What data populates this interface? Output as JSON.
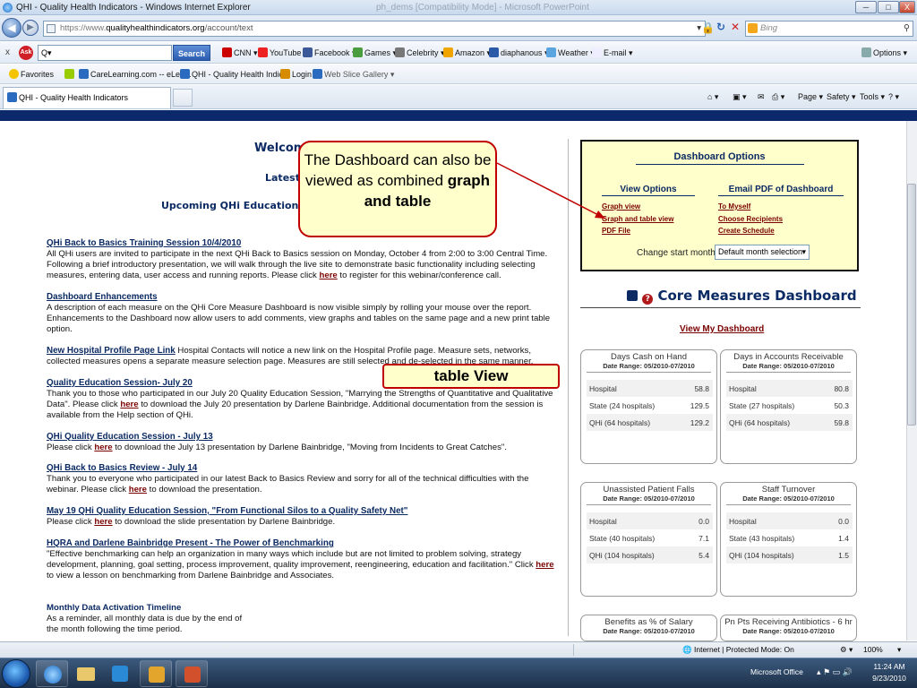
{
  "window": {
    "title": "QHI - Quality Health Indicators - Windows Internet Explorer",
    "faded_title": "ph_dems [Compatibility Mode] - Microsoft PowerPoint",
    "min": "─",
    "max": "□",
    "close": "X"
  },
  "address": {
    "url_prefix": "https://www.",
    "url_host": "qualityhealthindicators.org",
    "url_rest": "/account/text",
    "search_placeholder": "Bing"
  },
  "toolbar": {
    "search_value": "Q▾",
    "search_button": "Search",
    "items": [
      "CNN ▾",
      "YouTube",
      "Facebook ▾",
      "Games ▾",
      "Celebrity ▾",
      "Amazon ▾",
      "diaphanous ▾",
      "Weather ▾",
      "E-mail ▾"
    ],
    "options": "Options ▾"
  },
  "favorites": {
    "label": "Favorites",
    "items": [
      "CareLearning.com -- eLea...",
      "QHI - Quality Health Indic...",
      "Login",
      "Web Slice Gallery ▾"
    ]
  },
  "tab": {
    "label": "QHI - Quality Health Indicators"
  },
  "cmdbar": {
    "page": "Page ▾",
    "safety": "Safety ▾",
    "tools": "Tools ▾",
    "help": "? ▾"
  },
  "left": {
    "welcome": "Welcom",
    "latest": "Latest",
    "upcoming": "Upcoming QHi Educational We",
    "news": [
      {
        "title": "QHi Back to Basics Training Session 10/4/2010",
        "body": "All QHi users are invited to participate in the next QHi Back to Basics session on Monday, October 4 from 2:00 to 3:00 Central Time. Following a brief introductory presentation, we will walk through the live site to demonstrate basic functionality including selecting measures, entering data, user access and running reports. Please click ",
        "link": "here",
        "after": " to register for this webinar/conference call."
      },
      {
        "title": "Dashboard Enhancements",
        "body": "A description of each measure on the QHi Core Measure Dashboard is now visible simply by rolling your mouse over the report. Enhancements to the Dashboard now allow users to add comments, view graphs and tables on the same page and a new print table option.",
        "link": "",
        "after": ""
      },
      {
        "title": "New Hospital Profile Page Link",
        "inline": true,
        "body": " Hospital Contacts will notice a new link on the Hospital Profile page. Measure sets, networks, collected measures opens a separate measure selection page. Measures are still selected and de-selected in the same manner.",
        "link": "",
        "after": ""
      },
      {
        "title": "Quality Education Session- July 20",
        "body": "Thank you to those who participated in our July 20 Quality Education Session, \"Marrying the Strengths of Quantitative and Qualitative Data\". Please click ",
        "link": "here",
        "after": " to download the July 20 presentation by Darlene Bainbridge. Additional documentation from the session is available from the Help section of QHi."
      },
      {
        "title": "QHi Quality Education Session - July 13",
        "body": "Please click ",
        "link": "here",
        "after": " to download the July 13 presentation by Darlene Bainbridge, \"Moving from Incidents to Great Catches\"."
      },
      {
        "title": "QHi Back to Basics Review - July 14",
        "body": "Thank you to everyone who participated in our latest Back to Basics Review and sorry for all of the technical difficulties with the webinar. Please click ",
        "link": "here",
        "after": " to download the presentation."
      },
      {
        "title": "May 19 QHi Quality Education Session, \"From Functional Silos to a Quality Safety Net\"",
        "body": "Please click ",
        "link": "here",
        "after": " to download the slide presentation by Darlene Bainbridge."
      },
      {
        "title": "HQRA and Darlene Bainbridge Present - The Power of Benchmarking",
        "body": "\"Effective benchmarking can help an organization in many ways which include but are not limited to problem solving, strategy development, planning, goal setting, process improvement, quality improvement, reengineering, education and facilitation.\" Click ",
        "link": "here",
        "after": " to view a lesson on benchmarking from Darlene Bainbridge and Associates."
      }
    ],
    "monthly_title": "Monthly Data Activation Timeline",
    "monthly_body": "As a reminder, all monthly data is due by the end of the month following the time period."
  },
  "callouts": {
    "c1_part1": "The Dashboard can also be viewed as combined ",
    "c1_bold": "graph and table",
    "c2": "table View"
  },
  "dashboard_options": {
    "title": "Dashboard Options",
    "view_title": "View Options",
    "email_title": "Email PDF of Dashboard",
    "view_links": [
      "Graph view",
      "Graph and table view",
      "PDF File"
    ],
    "email_links": [
      "To Myself",
      "Choose Recipients",
      "Create Schedule"
    ],
    "start_label": "Change start month:",
    "start_value": "Default month selection"
  },
  "core": {
    "title": "Core Measures Dashboard",
    "view_my": "View My Dashboard"
  },
  "cards": [
    {
      "title": "Days Cash on Hand",
      "range": "Date Range: 05/2010-07/2010",
      "rows": [
        [
          "Hospital",
          "58.8"
        ],
        [
          "State (24 hospitals)",
          "129.5"
        ],
        [
          "QHi (64 hospitals)",
          "129.2"
        ]
      ]
    },
    {
      "title": "Days in Accounts Receivable",
      "range": "Date Range: 05/2010-07/2010",
      "rows": [
        [
          "Hospital",
          "80.8"
        ],
        [
          "State (27 hospitals)",
          "50.3"
        ],
        [
          "QHi (64 hospitals)",
          "59.8"
        ]
      ]
    },
    {
      "title": "Unassisted Patient Falls",
      "range": "Date Range: 05/2010-07/2010",
      "rows": [
        [
          "Hospital",
          "0.0"
        ],
        [
          "State (40 hospitals)",
          "7.1"
        ],
        [
          "QHi (104 hospitals)",
          "5.4"
        ]
      ]
    },
    {
      "title": "Staff Turnover",
      "range": "Date Range: 05/2010-07/2010",
      "rows": [
        [
          "Hospital",
          "0.0"
        ],
        [
          "State (43 hospitals)",
          "1.4"
        ],
        [
          "QHi (104 hospitals)",
          "1.5"
        ]
      ]
    },
    {
      "title": "Benefits as % of Salary",
      "range": "Date Range: 05/2010-07/2010",
      "rows": []
    },
    {
      "title": "Pn Pts Receiving Antibiotics - 6 hr",
      "range": "Date Range: 05/2010-07/2010",
      "rows": []
    }
  ],
  "status": {
    "zone": "Internet | Protected Mode: On",
    "zoom": "100%"
  },
  "taskbar": {
    "office": "Microsoft Office",
    "time": "11:24 AM",
    "date": "9/23/2010"
  }
}
